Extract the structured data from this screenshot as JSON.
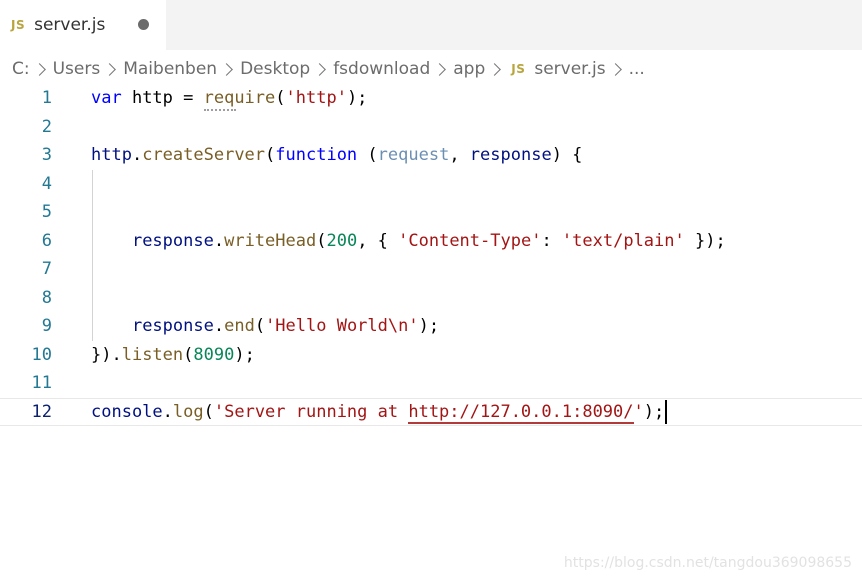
{
  "tab": {
    "icon": "JS",
    "label": "server.js",
    "dirty": true
  },
  "breadcrumb": {
    "items": [
      "C:",
      "Users",
      "Maibenben",
      "Desktop",
      "fsdownload",
      "app"
    ],
    "file_icon": "JS",
    "file": "server.js",
    "more": "..."
  },
  "editor": {
    "line_numbers": [
      "1",
      "2",
      "3",
      "4",
      "5",
      "6",
      "7",
      "8",
      "9",
      "10",
      "11",
      "12"
    ],
    "lines": {
      "l1": {
        "kw": "var",
        "name": " http = ",
        "fn": "require",
        "open": "(",
        "str": "'http'",
        "close": ");"
      },
      "l3": {
        "var": "http",
        "dot": ".",
        "fn": "createServer",
        "open": "(",
        "kw": "function",
        "sp": " (",
        "p1": "request",
        "comma": ", ",
        "p2": "response",
        "end": ") {"
      },
      "l6": {
        "indent": "    ",
        "var": "response",
        "dot": ".",
        "fn": "writeHead",
        "open": "(",
        "num": "200",
        "mid": ", { ",
        "key": "'Content-Type'",
        "colon": ": ",
        "val": "'text/plain'",
        "end": " });"
      },
      "l9": {
        "indent": "    ",
        "var": "response",
        "dot": ".",
        "fn": "end",
        "open": "(",
        "str": "'Hello World\\n'",
        "end": ");"
      },
      "l10": {
        "start": "}).",
        "fn": "listen",
        "open": "(",
        "num": "8090",
        "end": ");"
      },
      "l12": {
        "var": "console",
        "dot": ".",
        "fn": "log",
        "open": "(",
        "str1": "'Server running at ",
        "url": "http://127.0.0.1:8090/",
        "str2": "'",
        "end": ");"
      }
    },
    "active_line": "12"
  },
  "watermark": "https://blog.csdn.net/tangdou369098655",
  "colors": {
    "keyword": "#0000ff",
    "function": "#795e26",
    "string": "#a31515",
    "number": "#098658",
    "variable": "#001080",
    "line_number": "#237893"
  }
}
